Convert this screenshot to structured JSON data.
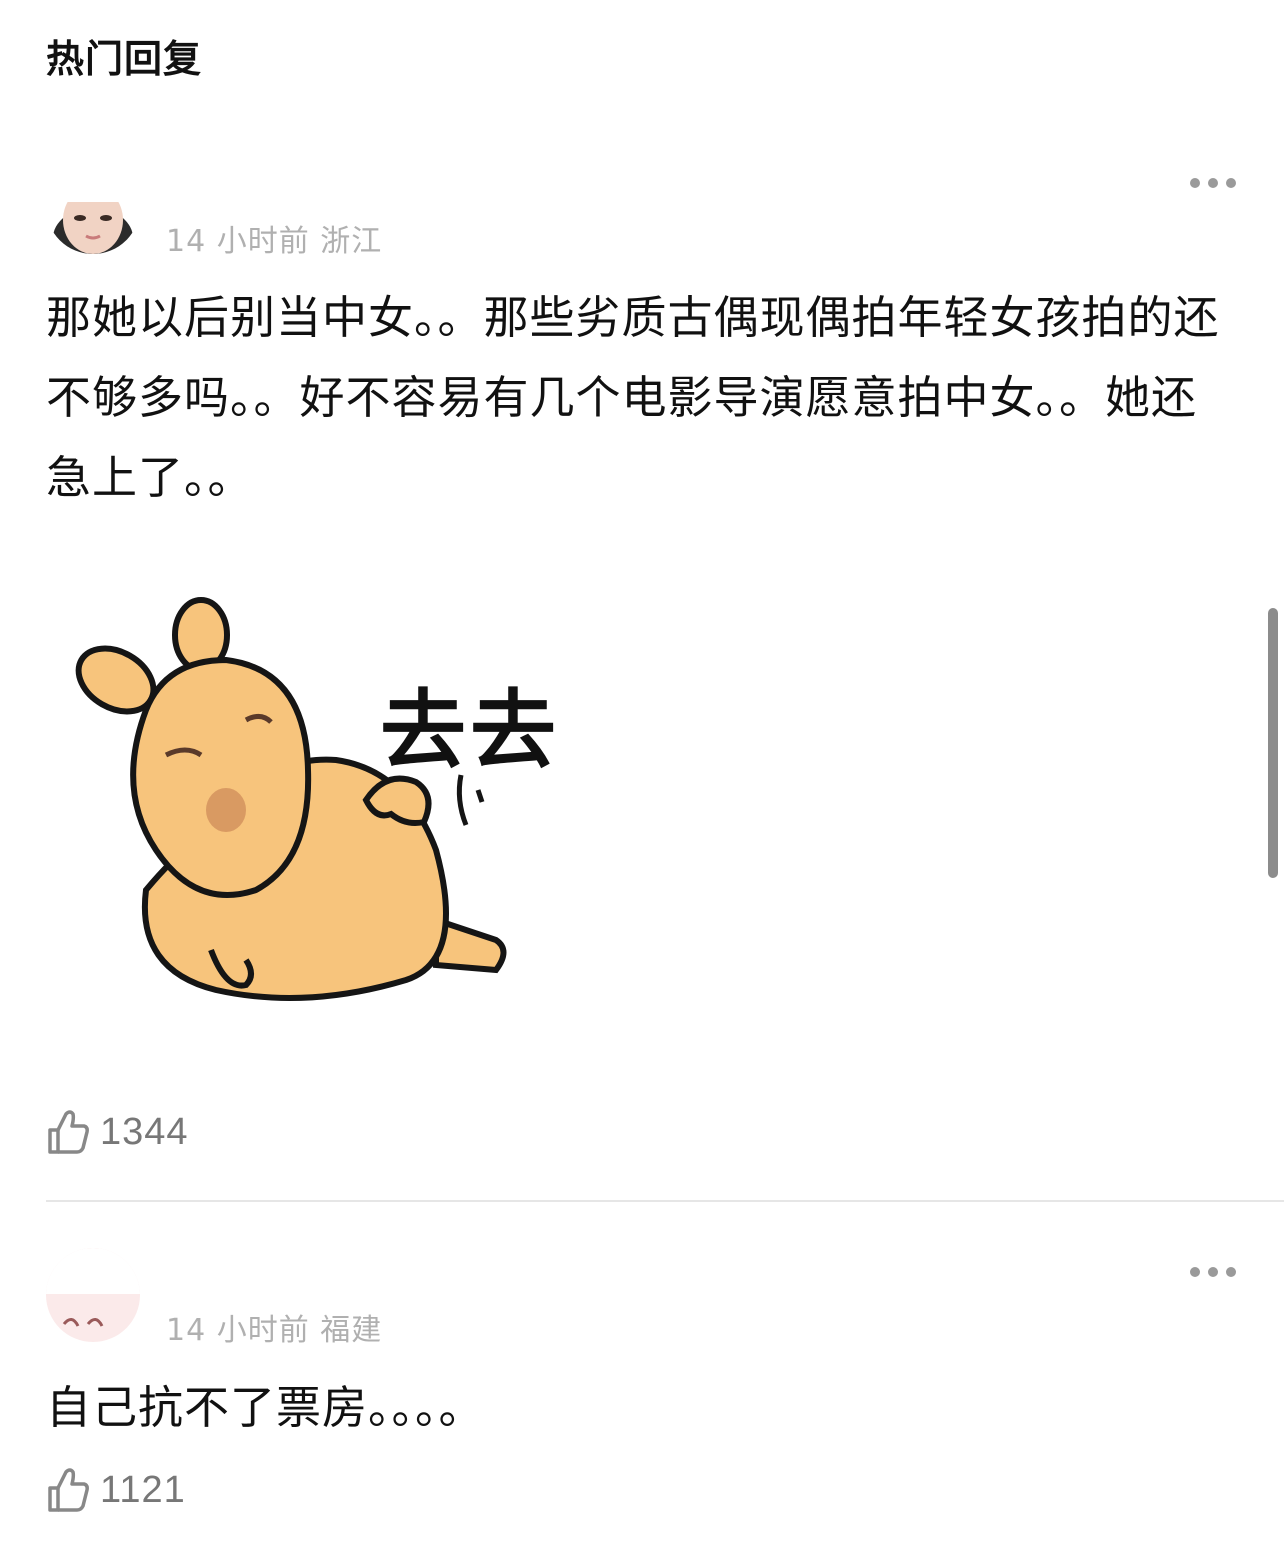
{
  "header": {
    "title": "热门回复"
  },
  "comments": [
    {
      "time": "14 小时前",
      "location": "浙江",
      "text": "那她以后别当中女。。那些劣质古偶现偶拍年轻女孩拍的还不够多吗。。好不容易有几个电影导演愿意拍中女。。她还急上了。。",
      "sticker_text": "去去",
      "likes": "1344"
    },
    {
      "time": "14 小时前",
      "location": "福建",
      "text": "自己抗不了票房。。。。",
      "likes": "1121"
    }
  ],
  "icons": {
    "more": "more-dots-icon",
    "like": "thumbs-up-icon"
  },
  "colors": {
    "meta_text": "#b0b0b0",
    "sticker_fill": "#f7c47c",
    "divider": "#e6e6e6"
  }
}
